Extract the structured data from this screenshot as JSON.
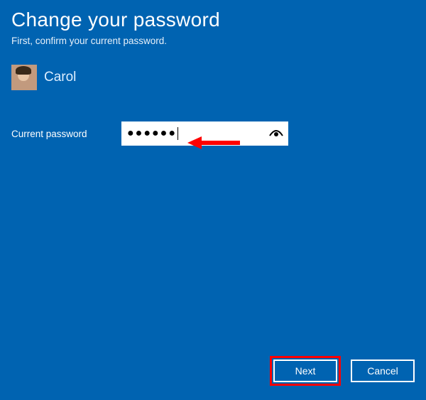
{
  "title": "Change your password",
  "subtitle": "First, confirm your current password.",
  "user": {
    "name": "Carol"
  },
  "field": {
    "label": "Current password",
    "masked_value": "●●●●●●",
    "placeholder": ""
  },
  "buttons": {
    "next": "Next",
    "cancel": "Cancel"
  },
  "icons": {
    "reveal": "password-reveal-icon",
    "arrow": "annotation-arrow"
  },
  "colors": {
    "background": "#0063b1",
    "highlight": "#ff0000"
  }
}
